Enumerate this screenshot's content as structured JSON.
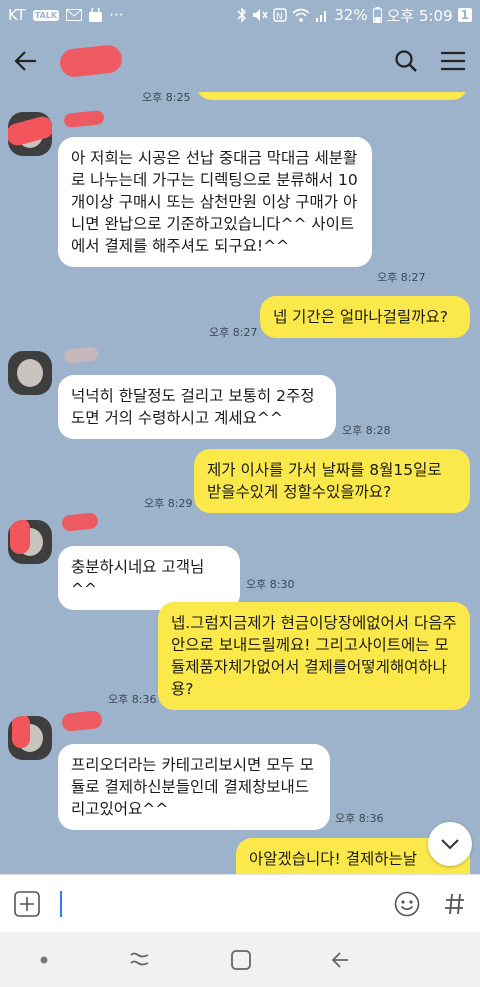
{
  "status_bar": {
    "carrier": "KT",
    "talk_badge": "TALK",
    "more": "···",
    "battery": "32%",
    "time": "오후 5:09",
    "badge": "1"
  },
  "header": {
    "title": ""
  },
  "messages": [
    {
      "side": "out",
      "time": "오후 8:25"
    },
    {
      "side": "in",
      "text": "아 저희는 시공은 선납 중대금 막대금 세분활로 나누는데 가구는 디렉팅으로 분류해서 10개이상 구매시 또는 삼천만원 이상 구매가 아니면 완납으로 기준하고있습니다^^ 사이트에서 결제를 해주셔도 되구요!^^",
      "time": "오후 8:27"
    },
    {
      "side": "out",
      "text": "넵 기간은 얼마나걸릴까요?",
      "time": "오후 8:27"
    },
    {
      "side": "in",
      "text": "넉넉히 한달정도 걸리고 보통히 2주정도면 거의 수령하시고 계세요^^",
      "time": "오후 8:28"
    },
    {
      "side": "out",
      "text": "제가 이사를 가서 날짜를 8월15일로 받을수있게 정할수있을까요?",
      "time": "오후 8:29"
    },
    {
      "side": "in",
      "text": "충분하시네요 고객님^^",
      "time": "오후 8:30"
    },
    {
      "side": "out",
      "text": "넵.그럼지금제가 현금이당장에없어서 다음주안으로 보내드릴께요! 그리고사이트에는 모듈제품자체가없어서 결제를어떻게해여하나용?",
      "time": "오후 8:36"
    },
    {
      "side": "in",
      "text": "프리오더라는 카테고리보시면 모두 모듈로 결제하신분들인데 결제창보내드리고있어요^^",
      "time": "오후 8:36"
    },
    {
      "side": "out",
      "text": "아알겠습니다! 결제하는날"
    }
  ],
  "colors": {
    "background": "#9db3cb",
    "outgoing": "#fbe84a",
    "incoming": "#ffffff"
  }
}
